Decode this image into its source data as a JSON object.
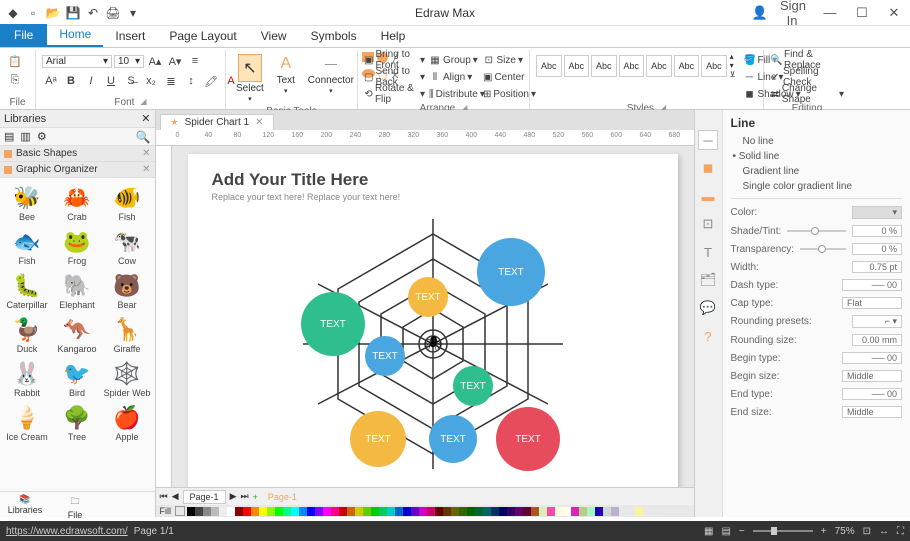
{
  "app": {
    "title": "Edraw Max",
    "signin": "Sign In"
  },
  "tabs": {
    "file": "File",
    "home": "Home",
    "insert": "Insert",
    "page_layout": "Page Layout",
    "view": "View",
    "symbols": "Symbols",
    "help": "Help"
  },
  "ribbon": {
    "file_group": "File",
    "font_group": "Font",
    "font_name": "Arial",
    "font_size": "10",
    "basic_tools": "Basic Tools",
    "select": "Select",
    "text": "Text",
    "connector": "Connector",
    "arrange_group": "Arrange",
    "bring_front": "Bring to Front",
    "send_back": "Send to Back",
    "rotate_flip": "Rotate & Flip",
    "group": "Group",
    "align": "Align",
    "distribute": "Distribute",
    "size": "Size",
    "center": "Center",
    "position": "Position",
    "styles_group": "Styles",
    "style_abc": "Abc",
    "fill": "Fill",
    "line": "Line",
    "shadow": "Shadow",
    "editing_group": "Editing",
    "find_replace": "Find & Replace",
    "spelling": "Spelling Check",
    "change_shape": "Change Shape"
  },
  "libraries": {
    "title": "Libraries",
    "cat1": "Basic Shapes",
    "cat2": "Graphic Organizer",
    "shapes": [
      {
        "i": "🐝",
        "n": "Bee"
      },
      {
        "i": "🦀",
        "n": "Crab"
      },
      {
        "i": "🐠",
        "n": "Fish"
      },
      {
        "i": "🐟",
        "n": "Fish"
      },
      {
        "i": "🐸",
        "n": "Frog"
      },
      {
        "i": "🐄",
        "n": "Cow"
      },
      {
        "i": "🐛",
        "n": "Caterpillar"
      },
      {
        "i": "🐘",
        "n": "Elephant"
      },
      {
        "i": "🐻",
        "n": "Bear"
      },
      {
        "i": "🦆",
        "n": "Duck"
      },
      {
        "i": "🦘",
        "n": "Kangaroo"
      },
      {
        "i": "🦒",
        "n": "Giraffe"
      },
      {
        "i": "🐰",
        "n": "Rabbit"
      },
      {
        "i": "🐦",
        "n": "Bird"
      },
      {
        "i": "🕸️",
        "n": "Spider Web"
      },
      {
        "i": "🍦",
        "n": "Ice Cream"
      },
      {
        "i": "🌳",
        "n": "Tree"
      },
      {
        "i": "🍎",
        "n": "Apple"
      }
    ],
    "footer1": "Libraries",
    "footer2": "File Recovery"
  },
  "doc": {
    "tab": "Spider Chart 1",
    "title": "Add Your Title Here",
    "sub": "Replace your text here!   Replace your text here!",
    "bubble": "TEXT",
    "page_tab": "Page-1",
    "ruler_marks": [
      "0",
      "40",
      "80",
      "120",
      "160",
      "200",
      "240",
      "280",
      "320",
      "360",
      "400",
      "440",
      "480",
      "520",
      "560",
      "600",
      "640",
      "680"
    ]
  },
  "line_panel": {
    "title": "Line",
    "no_line": "No line",
    "solid": "Solid line",
    "gradient": "Gradient line",
    "single_grad": "Single color gradient line",
    "color": "Color:",
    "shade": "Shade/Tint:",
    "shade_val": "0 %",
    "transparency": "Transparency:",
    "trans_val": "0 %",
    "width": "Width:",
    "width_val": "0.75 pt",
    "dash": "Dash type:",
    "dash_val": "00",
    "cap": "Cap type:",
    "cap_val": "Flat",
    "round_preset": "Rounding presets:",
    "round_size": "Rounding size:",
    "round_val": "0.00 mm",
    "begin_type": "Begin type:",
    "begin_type_val": "00",
    "begin_size": "Begin size:",
    "begin_size_val": "Middle",
    "end_type": "End type:",
    "end_type_val": "00",
    "end_size": "End size:",
    "end_size_val": "Middle"
  },
  "status": {
    "url": "https://www.edrawsoft.com/",
    "page": "Page 1/1",
    "fill": "Fill",
    "zoom": "75%"
  },
  "colorbar": [
    "#000",
    "#444",
    "#888",
    "#bbb",
    "#eee",
    "#fff",
    "#800",
    "#f00",
    "#f80",
    "#ff0",
    "#8f0",
    "#0f0",
    "#0f8",
    "#0ff",
    "#08f",
    "#00f",
    "#80f",
    "#f0f",
    "#f08",
    "#c00",
    "#c60",
    "#cc0",
    "#6c0",
    "#0c0",
    "#0c6",
    "#0cc",
    "#06c",
    "#00c",
    "#60c",
    "#c0c",
    "#c06",
    "#600",
    "#630",
    "#660",
    "#360",
    "#060",
    "#063",
    "#066",
    "#036",
    "#006",
    "#306",
    "#606",
    "#603",
    "#a52",
    "#deb",
    "#f4a",
    "#ffd",
    "#ffe",
    "#d2b",
    "#bc8",
    "#8fbc",
    "#20b",
    "#4682",
    "#6495",
    "#9370",
    "#da70",
    "#ff69"
  ]
}
